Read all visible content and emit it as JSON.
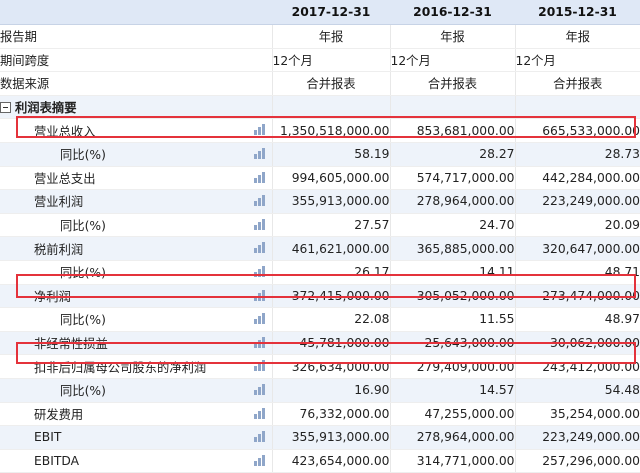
{
  "header": {
    "col1": "2017-12-31",
    "col2": "2016-12-31",
    "col3": "2015-12-31"
  },
  "meta_rows": [
    {
      "label": "报告期",
      "values": [
        "年报",
        "年报",
        "年报"
      ]
    },
    {
      "label": "期间跨度",
      "values": [
        "12个月",
        "12个月",
        "12个月"
      ]
    },
    {
      "label": "数据来源",
      "values": [
        "合并报表",
        "合并报表",
        "合并报表"
      ]
    }
  ],
  "section": {
    "label": "利润表摘要"
  },
  "rows": [
    {
      "label": "营业总收入",
      "values": [
        "1,350,518,000.00",
        "853,681,000.00",
        "665,533,000.00"
      ]
    },
    {
      "label": "同比(%)",
      "values": [
        "58.19",
        "28.27",
        "28.73"
      ]
    },
    {
      "label": "营业总支出",
      "values": [
        "994,605,000.00",
        "574,717,000.00",
        "442,284,000.00"
      ]
    },
    {
      "label": "营业利润",
      "values": [
        "355,913,000.00",
        "278,964,000.00",
        "223,249,000.00"
      ]
    },
    {
      "label": "同比(%)",
      "values": [
        "27.57",
        "24.70",
        "20.09"
      ]
    },
    {
      "label": "税前利润",
      "values": [
        "461,621,000.00",
        "365,885,000.00",
        "320,647,000.00"
      ]
    },
    {
      "label": "同比(%)",
      "values": [
        "26.17",
        "14.11",
        "48.71"
      ]
    },
    {
      "label": "净利润",
      "values": [
        "372,415,000.00",
        "305,052,000.00",
        "273,474,000.00"
      ]
    },
    {
      "label": "同比(%)",
      "values": [
        "22.08",
        "11.55",
        "48.97"
      ]
    },
    {
      "label": "非经常性损益",
      "values": [
        "45,781,000.00",
        "25,643,000.00",
        "30,062,000.00"
      ]
    },
    {
      "label": "扣非后归属母公司股东的净利润",
      "values": [
        "326,634,000.00",
        "279,409,000.00",
        "243,412,000.00"
      ]
    },
    {
      "label": "同比(%)",
      "values": [
        "16.90",
        "14.57",
        "54.48"
      ]
    },
    {
      "label": "研发费用",
      "values": [
        "76,332,000.00",
        "47,255,000.00",
        "35,254,000.00"
      ]
    },
    {
      "label": "EBIT",
      "values": [
        "355,913,000.00",
        "278,964,000.00",
        "223,249,000.00"
      ]
    },
    {
      "label": "EBITDA",
      "values": [
        "423,654,000.00",
        "314,771,000.00",
        "257,296,000.00"
      ]
    }
  ],
  "colors": {
    "highlight_box": "#e4323b",
    "header_bg": "#dfe8f6",
    "icon": "#8fa6c9"
  }
}
